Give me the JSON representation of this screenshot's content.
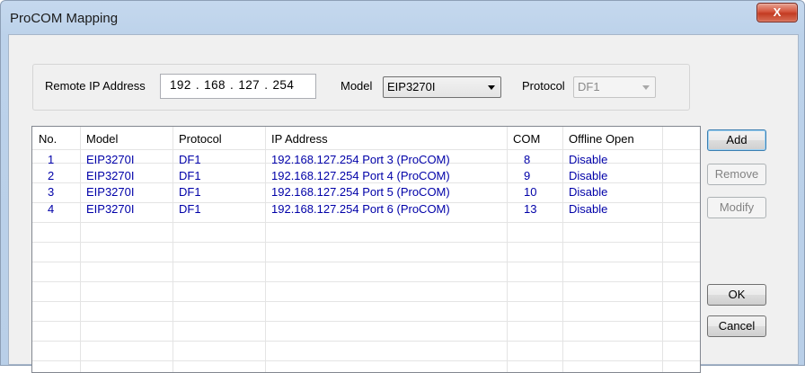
{
  "window": {
    "title": "ProCOM Mapping",
    "close_label": "X"
  },
  "settings": {
    "remote_ip_label": "Remote IP Address",
    "remote_ip_value": "192 . 168 . 127 . 254",
    "model_label": "Model",
    "model_value": "EIP3270I",
    "protocol_label": "Protocol",
    "protocol_value": "DF1"
  },
  "table": {
    "columns": [
      "No.",
      "Model",
      "Protocol",
      "IP Address",
      "COM",
      "Offline Open"
    ],
    "rows": [
      [
        "1",
        "EIP3270I",
        "DF1",
        "192.168.127.254 Port 3 (ProCOM)",
        "8",
        "Disable"
      ],
      [
        "2",
        "EIP3270I",
        "DF1",
        "192.168.127.254 Port 4 (ProCOM)",
        "9",
        "Disable"
      ],
      [
        "3",
        "EIP3270I",
        "DF1",
        "192.168.127.254 Port 5 (ProCOM)",
        "10",
        "Disable"
      ],
      [
        "4",
        "EIP3270I",
        "DF1",
        "192.168.127.254 Port 6 (ProCOM)",
        "13",
        "Disable"
      ]
    ]
  },
  "buttons": {
    "add": "Add",
    "remove": "Remove",
    "modify": "Modify",
    "ok": "OK",
    "cancel": "Cancel"
  }
}
